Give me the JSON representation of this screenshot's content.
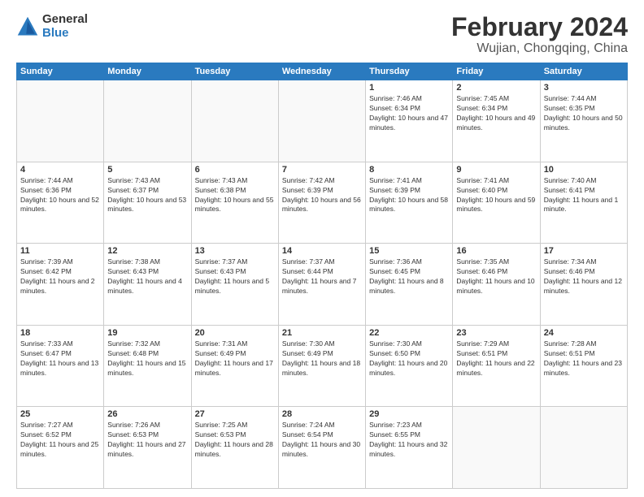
{
  "header": {
    "logo_general": "General",
    "logo_blue": "Blue",
    "title": "February 2024",
    "subtitle": "Wujian, Chongqing, China"
  },
  "days_of_week": [
    "Sunday",
    "Monday",
    "Tuesday",
    "Wednesday",
    "Thursday",
    "Friday",
    "Saturday"
  ],
  "weeks": [
    [
      {
        "day": "",
        "info": ""
      },
      {
        "day": "",
        "info": ""
      },
      {
        "day": "",
        "info": ""
      },
      {
        "day": "",
        "info": ""
      },
      {
        "day": "1",
        "info": "Sunrise: 7:46 AM\nSunset: 6:34 PM\nDaylight: 10 hours and 47 minutes."
      },
      {
        "day": "2",
        "info": "Sunrise: 7:45 AM\nSunset: 6:34 PM\nDaylight: 10 hours and 49 minutes."
      },
      {
        "day": "3",
        "info": "Sunrise: 7:44 AM\nSunset: 6:35 PM\nDaylight: 10 hours and 50 minutes."
      }
    ],
    [
      {
        "day": "4",
        "info": "Sunrise: 7:44 AM\nSunset: 6:36 PM\nDaylight: 10 hours and 52 minutes."
      },
      {
        "day": "5",
        "info": "Sunrise: 7:43 AM\nSunset: 6:37 PM\nDaylight: 10 hours and 53 minutes."
      },
      {
        "day": "6",
        "info": "Sunrise: 7:43 AM\nSunset: 6:38 PM\nDaylight: 10 hours and 55 minutes."
      },
      {
        "day": "7",
        "info": "Sunrise: 7:42 AM\nSunset: 6:39 PM\nDaylight: 10 hours and 56 minutes."
      },
      {
        "day": "8",
        "info": "Sunrise: 7:41 AM\nSunset: 6:39 PM\nDaylight: 10 hours and 58 minutes."
      },
      {
        "day": "9",
        "info": "Sunrise: 7:41 AM\nSunset: 6:40 PM\nDaylight: 10 hours and 59 minutes."
      },
      {
        "day": "10",
        "info": "Sunrise: 7:40 AM\nSunset: 6:41 PM\nDaylight: 11 hours and 1 minute."
      }
    ],
    [
      {
        "day": "11",
        "info": "Sunrise: 7:39 AM\nSunset: 6:42 PM\nDaylight: 11 hours and 2 minutes."
      },
      {
        "day": "12",
        "info": "Sunrise: 7:38 AM\nSunset: 6:43 PM\nDaylight: 11 hours and 4 minutes."
      },
      {
        "day": "13",
        "info": "Sunrise: 7:37 AM\nSunset: 6:43 PM\nDaylight: 11 hours and 5 minutes."
      },
      {
        "day": "14",
        "info": "Sunrise: 7:37 AM\nSunset: 6:44 PM\nDaylight: 11 hours and 7 minutes."
      },
      {
        "day": "15",
        "info": "Sunrise: 7:36 AM\nSunset: 6:45 PM\nDaylight: 11 hours and 8 minutes."
      },
      {
        "day": "16",
        "info": "Sunrise: 7:35 AM\nSunset: 6:46 PM\nDaylight: 11 hours and 10 minutes."
      },
      {
        "day": "17",
        "info": "Sunrise: 7:34 AM\nSunset: 6:46 PM\nDaylight: 11 hours and 12 minutes."
      }
    ],
    [
      {
        "day": "18",
        "info": "Sunrise: 7:33 AM\nSunset: 6:47 PM\nDaylight: 11 hours and 13 minutes."
      },
      {
        "day": "19",
        "info": "Sunrise: 7:32 AM\nSunset: 6:48 PM\nDaylight: 11 hours and 15 minutes."
      },
      {
        "day": "20",
        "info": "Sunrise: 7:31 AM\nSunset: 6:49 PM\nDaylight: 11 hours and 17 minutes."
      },
      {
        "day": "21",
        "info": "Sunrise: 7:30 AM\nSunset: 6:49 PM\nDaylight: 11 hours and 18 minutes."
      },
      {
        "day": "22",
        "info": "Sunrise: 7:30 AM\nSunset: 6:50 PM\nDaylight: 11 hours and 20 minutes."
      },
      {
        "day": "23",
        "info": "Sunrise: 7:29 AM\nSunset: 6:51 PM\nDaylight: 11 hours and 22 minutes."
      },
      {
        "day": "24",
        "info": "Sunrise: 7:28 AM\nSunset: 6:51 PM\nDaylight: 11 hours and 23 minutes."
      }
    ],
    [
      {
        "day": "25",
        "info": "Sunrise: 7:27 AM\nSunset: 6:52 PM\nDaylight: 11 hours and 25 minutes."
      },
      {
        "day": "26",
        "info": "Sunrise: 7:26 AM\nSunset: 6:53 PM\nDaylight: 11 hours and 27 minutes."
      },
      {
        "day": "27",
        "info": "Sunrise: 7:25 AM\nSunset: 6:53 PM\nDaylight: 11 hours and 28 minutes."
      },
      {
        "day": "28",
        "info": "Sunrise: 7:24 AM\nSunset: 6:54 PM\nDaylight: 11 hours and 30 minutes."
      },
      {
        "day": "29",
        "info": "Sunrise: 7:23 AM\nSunset: 6:55 PM\nDaylight: 11 hours and 32 minutes."
      },
      {
        "day": "",
        "info": ""
      },
      {
        "day": "",
        "info": ""
      }
    ]
  ]
}
